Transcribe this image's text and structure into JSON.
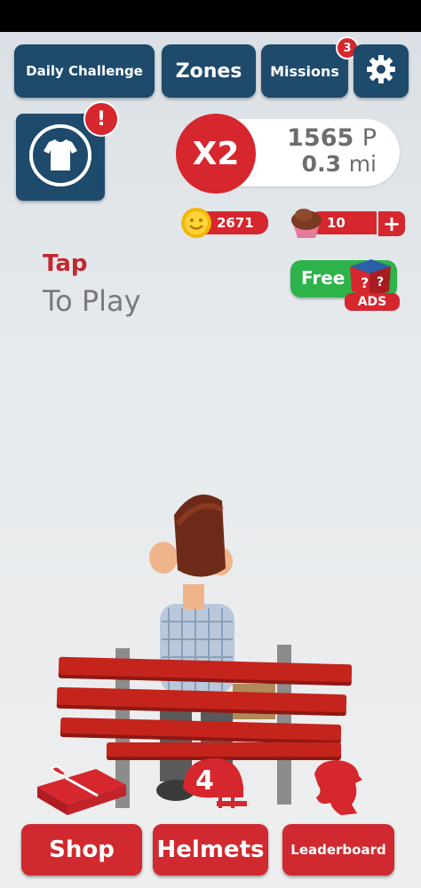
{
  "top_bar": {
    "daily_challenge_label": "Daily Challenge",
    "zones_label": "Zones",
    "missions_label": "Missions",
    "missions_badge": "3"
  },
  "outfit": {
    "alert_badge": "!"
  },
  "score": {
    "multiplier": "X2",
    "points": "1565",
    "points_unit": "P",
    "distance": "0.3",
    "distance_unit": "mi"
  },
  "currency": {
    "coins": "2671",
    "cupcakes": "10",
    "add_label": "+"
  },
  "free_box": {
    "label": "Free",
    "ads_label": "ADS"
  },
  "prompt": {
    "tap": "Tap",
    "to_play": "To Play"
  },
  "bottom": {
    "shop_label": "Shop",
    "helmets_label": "Helmets",
    "helmet_count": "4",
    "leaderboard_label": "Leaderboard"
  },
  "colors": {
    "navy": "#1e4a6b",
    "red": "#d6262e",
    "green": "#2db34a"
  }
}
